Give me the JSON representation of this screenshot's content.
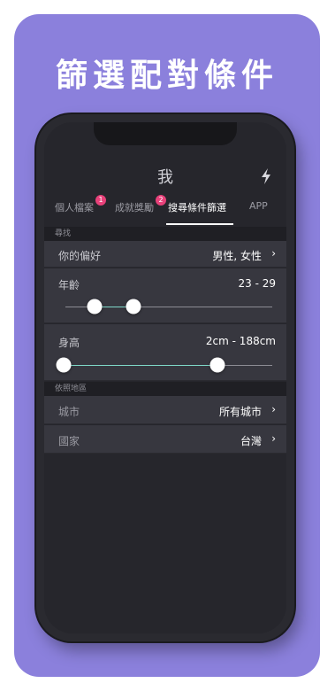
{
  "headline": "篩選配對條件",
  "app": {
    "title": "我",
    "flash_icon": "lightning-icon"
  },
  "tabs": [
    {
      "label": "個人檔案",
      "badge": "1"
    },
    {
      "label": "成就獎勵",
      "badge": "2"
    },
    {
      "label": "搜尋條件篩選",
      "active": true
    },
    {
      "label": "APP"
    }
  ],
  "sections": {
    "find_label": "尋找",
    "region_label": "依照地區"
  },
  "preference": {
    "label": "你的偏好",
    "value": "男性, 女性"
  },
  "age": {
    "label": "年齡",
    "value": "23 - 29",
    "min": 23,
    "max": 29
  },
  "height": {
    "label": "身高",
    "value": "2cm - 188cm",
    "min": 2,
    "max": 188
  },
  "city": {
    "label": "城市",
    "value": "所有城市"
  },
  "country": {
    "label": "國家",
    "value": "台灣"
  },
  "colors": {
    "background": "#8b80dc",
    "screen": "#26262c",
    "row": "#37373f",
    "badge": "#e8417a",
    "slider_fill": "#7fd8c8"
  }
}
